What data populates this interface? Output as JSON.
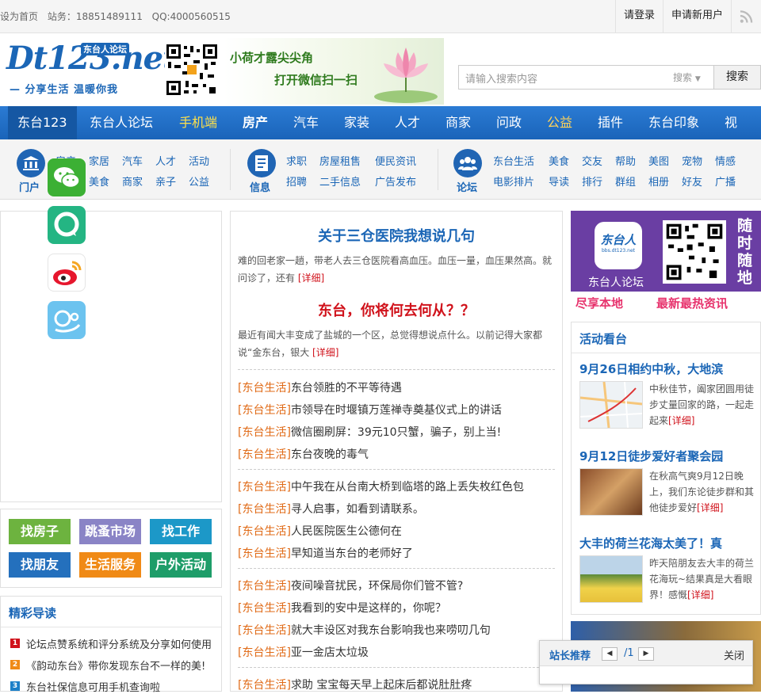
{
  "topbar": {
    "home": "设为首页",
    "station": "站务：18851489111",
    "qq": "QQ:4000560515",
    "login": "请登录",
    "register": "申请新用户"
  },
  "logo": {
    "main": "Dt123.net",
    "tag": "东台人论坛",
    "slogan": "— 分享生活 温暖你我"
  },
  "banner": {
    "line1": "小荷才露尖尖角",
    "line2": "打开微信扫一扫"
  },
  "search": {
    "placeholder": "请输入搜索内容",
    "select": "搜索",
    "button": "搜索"
  },
  "nav": [
    "东台123",
    "东台人论坛",
    "手机端",
    "房产",
    "汽车",
    "家装",
    "人才",
    "商家",
    "问政",
    "公益",
    "插件",
    "东台印象",
    "视"
  ],
  "subnav": {
    "portal_label": "门户",
    "portal": [
      "房产",
      "家居",
      "汽车",
      "人才",
      "活动",
      "美食",
      "商家",
      "亲子",
      "公益"
    ],
    "info_label": "信息",
    "info": [
      "求职",
      "房屋租售",
      "便民资讯",
      "招聘",
      "二手信息",
      "广告发布"
    ],
    "forum_label": "论坛",
    "forum": [
      "东台生活",
      "美食",
      "交友",
      "帮助",
      "美图",
      "宠物",
      "情感",
      "电影排片",
      "导读",
      "排行",
      "群组",
      "相册",
      "好友",
      "广播"
    ]
  },
  "buttons": [
    "找房子",
    "跳蚤市场",
    "找工作",
    "找朋友",
    "生活服务",
    "户外活动"
  ],
  "reading": {
    "title": "精彩导读",
    "items": [
      "论坛点赞系统和评分系统及分享如何使用",
      "《韵动东台》带你发现东台不一样的美!",
      "东台社保信息可用手机查询啦"
    ],
    "ranks": [
      "1",
      "2",
      "3"
    ]
  },
  "featured": [
    {
      "title": "关于三仓医院我想说几句",
      "text": "难的回老家一趟，带老人去三仓医院看高血压。血压一量，血压果然高。就问诊了，还有",
      "more": "[详细]"
    },
    {
      "title": "东台，你将何去何从？？",
      "text": "最近有闻大丰变成了盐城的一个区，总觉得想说点什么。以前记得大家都说“金东台，银大",
      "more": "[详细]"
    }
  ],
  "news": [
    {
      "cat": "[东台生活]",
      "title": "东台领胜的不平等待遇"
    },
    {
      "cat": "[东台生活]",
      "title": "市领导在时堰镇万莲禅寺奠基仪式上的讲话"
    },
    {
      "cat": "[东台生活]",
      "title": "微信圈刷屏：39元10只蟹，骗子，别上当!"
    },
    {
      "cat": "[东台生活]",
      "title": "东台夜晚的毒气"
    },
    {
      "cat": "[东台生活]",
      "title": "中午我在从台南大桥到临塔的路上丢失枚红色包"
    },
    {
      "cat": "[东台生活]",
      "title": "寻人启事，如看到请联系。"
    },
    {
      "cat": "[东台生活]",
      "title": "人民医院医生公德何在"
    },
    {
      "cat": "[东台生活]",
      "title": "早知道当东台的老师好了"
    },
    {
      "cat": "[东台生活]",
      "title": "夜间噪音扰民，环保局你们管不管?"
    },
    {
      "cat": "[东台生活]",
      "title": "我看到的安中是这样的，你呢？"
    },
    {
      "cat": "[东台生活]",
      "title": "就大丰设区对我东台影响我也来唠叨几句"
    },
    {
      "cat": "[东台生活]",
      "title": "亚一金店太垃圾"
    },
    {
      "cat": "[东台生活]",
      "title": "求助 宝宝每天早上起床后都说肚肚疼"
    }
  ],
  "ad": {
    "brand": "东台人",
    "site": "bbs.dt123.net",
    "label": "东台人论坛",
    "side": "随时随地",
    "bottom": "尽享本地",
    "bottom2": "最新最热资讯"
  },
  "activity": {
    "title": "活动看台",
    "items": [
      {
        "title": "9月26日相约中秋，大地滨",
        "text": "中秋佳节，阖家团圆用徒步丈量回家的路，一起走起来",
        "more": "[详细]"
      },
      {
        "title": "9月12日徒步爱好者聚会园",
        "text": "在秋高气爽9月12日晚上，我们东论徒步群和其他徒步爱好",
        "more": "[详细]"
      },
      {
        "title": "大丰的荷兰花海太美了！真",
        "text": "昨天陪朋友去大丰的荷兰花海玩~结果真是大看眼界！感慨",
        "more": "[详细]"
      }
    ]
  },
  "popup": {
    "title": "站长推荐",
    "page": "/1",
    "close": "关闭"
  },
  "colors": {
    "nav": "#1a64b9",
    "accent": "#1b66b6",
    "cat": "#e06a16",
    "red": "#d0121b"
  }
}
